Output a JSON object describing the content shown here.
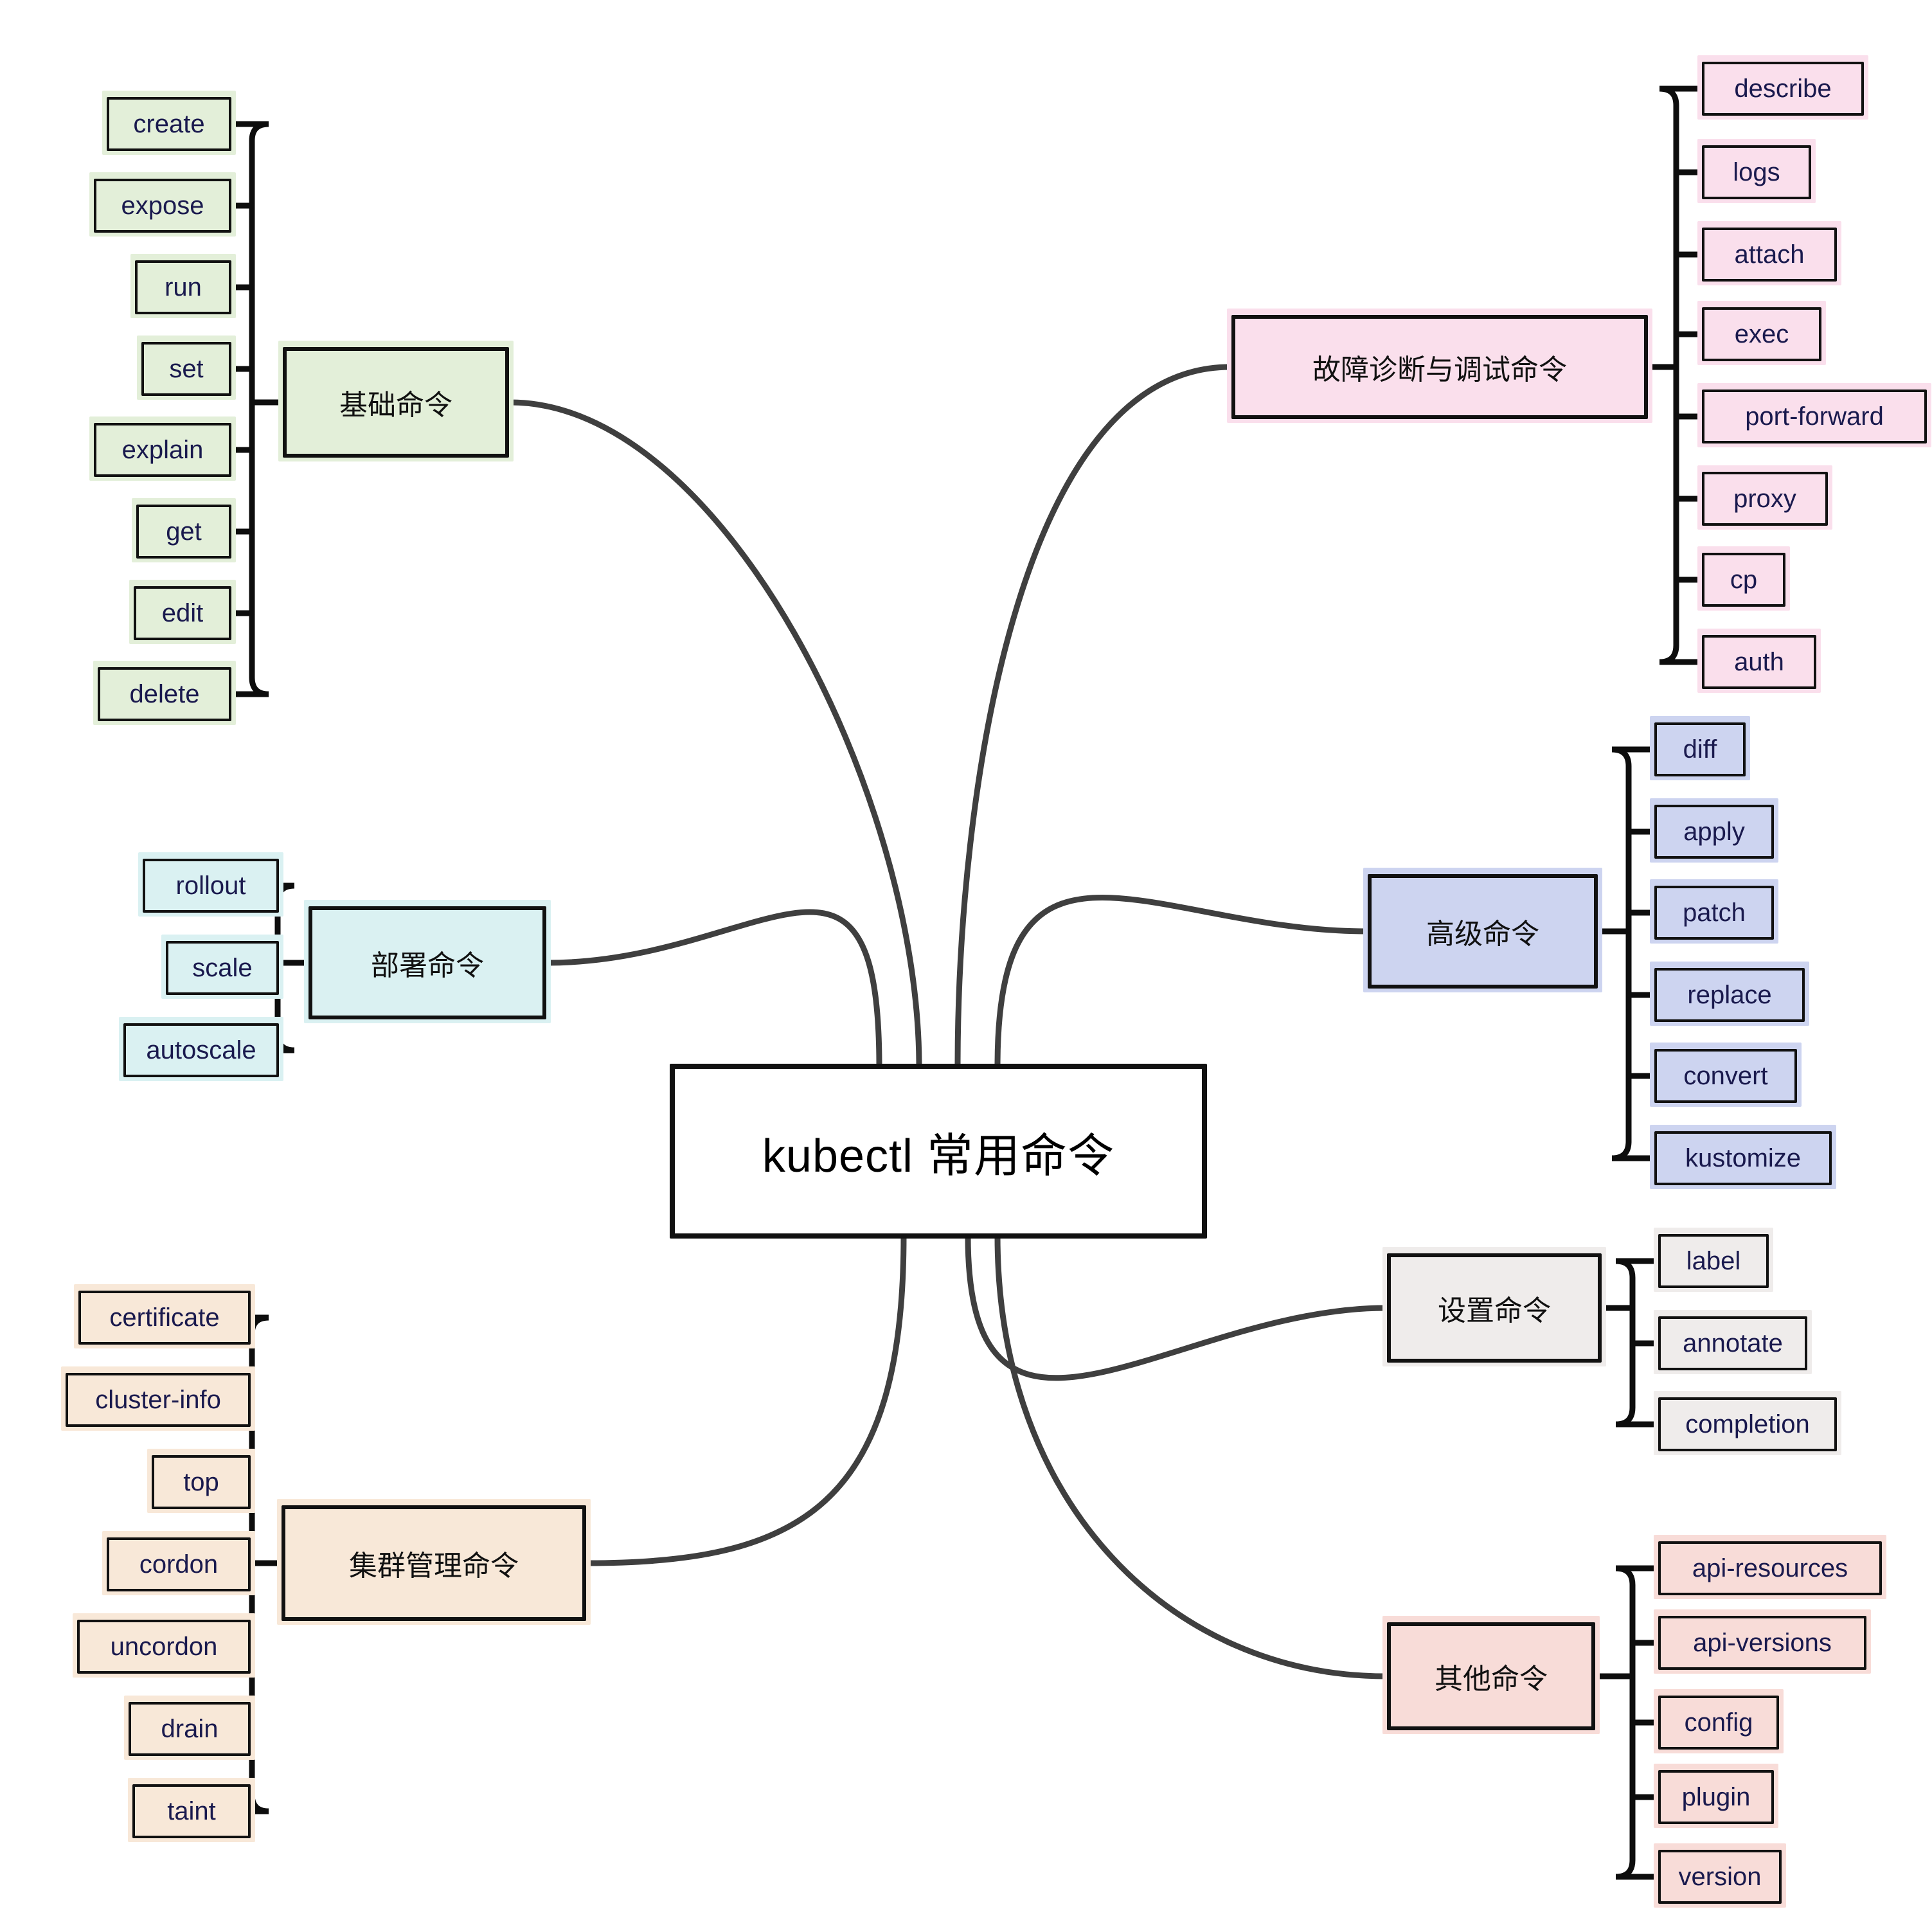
{
  "diagram": {
    "type": "mindmap",
    "root": {
      "label": "kubectl 常用命令",
      "fill": "#ffffff",
      "stroke": "#000000"
    },
    "link_color": "#4a4a4a",
    "branches": [
      {
        "id": "basic",
        "label": "基础命令",
        "fill": "#e3efd9",
        "side": "left",
        "children": [
          {
            "label": "create"
          },
          {
            "label": "expose"
          },
          {
            "label": "run"
          },
          {
            "label": "set"
          },
          {
            "label": "explain"
          },
          {
            "label": "get"
          },
          {
            "label": "edit"
          },
          {
            "label": "delete"
          }
        ]
      },
      {
        "id": "deploy",
        "label": "部署命令",
        "fill": "#daf1f2",
        "side": "left",
        "children": [
          {
            "label": "rollout"
          },
          {
            "label": "scale"
          },
          {
            "label": "autoscale"
          }
        ]
      },
      {
        "id": "cluster",
        "label": "集群管理命令",
        "fill": "#f8e8d8",
        "side": "left",
        "children": [
          {
            "label": "certificate"
          },
          {
            "label": "cluster-info"
          },
          {
            "label": "top"
          },
          {
            "label": "cordon"
          },
          {
            "label": "uncordon"
          },
          {
            "label": "drain"
          },
          {
            "label": "taint"
          }
        ]
      },
      {
        "id": "debug",
        "label": "故障诊断与调试命令",
        "fill": "#fadfec",
        "side": "right",
        "children": [
          {
            "label": "describe"
          },
          {
            "label": "logs"
          },
          {
            "label": "attach"
          },
          {
            "label": "exec"
          },
          {
            "label": "port-forward"
          },
          {
            "label": "proxy"
          },
          {
            "label": "cp"
          },
          {
            "label": "auth"
          }
        ]
      },
      {
        "id": "advanced",
        "label": "高级命令",
        "fill": "#cdd4f0",
        "side": "right",
        "children": [
          {
            "label": "diff"
          },
          {
            "label": "apply"
          },
          {
            "label": "patch"
          },
          {
            "label": "replace"
          },
          {
            "label": "convert"
          },
          {
            "label": "kustomize"
          }
        ]
      },
      {
        "id": "settings",
        "label": "设置命令",
        "fill": "#efeceb",
        "side": "right",
        "children": [
          {
            "label": "label"
          },
          {
            "label": "annotate"
          },
          {
            "label": "completion"
          }
        ]
      },
      {
        "id": "other",
        "label": "其他命令",
        "fill": "#f8dcd8",
        "side": "right",
        "children": [
          {
            "label": "api-resources"
          },
          {
            "label": "api-versions"
          },
          {
            "label": "config"
          },
          {
            "label": "plugin"
          },
          {
            "label": "version"
          }
        ]
      }
    ]
  }
}
